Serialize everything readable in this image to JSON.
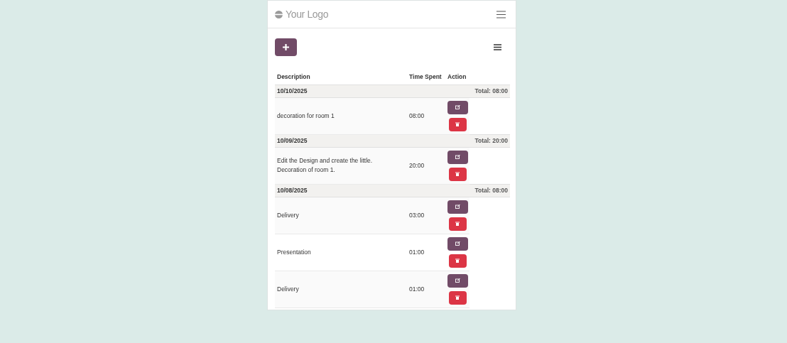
{
  "header": {
    "logo_text": "Your Logo"
  },
  "table": {
    "columns": [
      "Description",
      "Time Spent",
      "Action"
    ],
    "groups": [
      {
        "date": "10/10/2025",
        "total": "Total: 08:00",
        "rows": [
          {
            "description": "decoration for room 1",
            "time": "08:00"
          }
        ]
      },
      {
        "date": "10/09/2025",
        "total": "Total: 20:00",
        "rows": [
          {
            "description": "Edit the Design and create the little. Decoration of room 1.",
            "time": "20:00"
          }
        ]
      },
      {
        "date": "10/08/2025",
        "total": "Total: 08:00",
        "rows": [
          {
            "description": "Delivery",
            "time": "03:00"
          },
          {
            "description": "Presentation",
            "time": "01:00"
          },
          {
            "description": "Delivery",
            "time": "01:00"
          }
        ]
      }
    ]
  }
}
